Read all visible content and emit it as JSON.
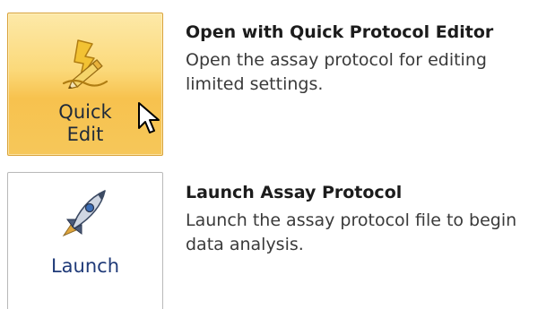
{
  "actions": [
    {
      "id": "quick-edit",
      "tile_label": "Quick\nEdit",
      "icon": "pencil-lightning-icon",
      "title": "Open with Quick Protocol Editor",
      "description": "Open the assay protocol for editing\nlimited settings.",
      "state": "hover"
    },
    {
      "id": "launch",
      "tile_label": "Launch",
      "icon": "rocket-icon",
      "title": "Launch Assay Protocol",
      "description": "Launch the assay protocol file to begin\ndata analysis.",
      "state": "normal"
    }
  ],
  "colors": {
    "hover_tile": "#f7c24e",
    "hover_border": "#d9a23a",
    "normal_border": "#b9b9b9",
    "launch_label": "#1f3a78"
  }
}
